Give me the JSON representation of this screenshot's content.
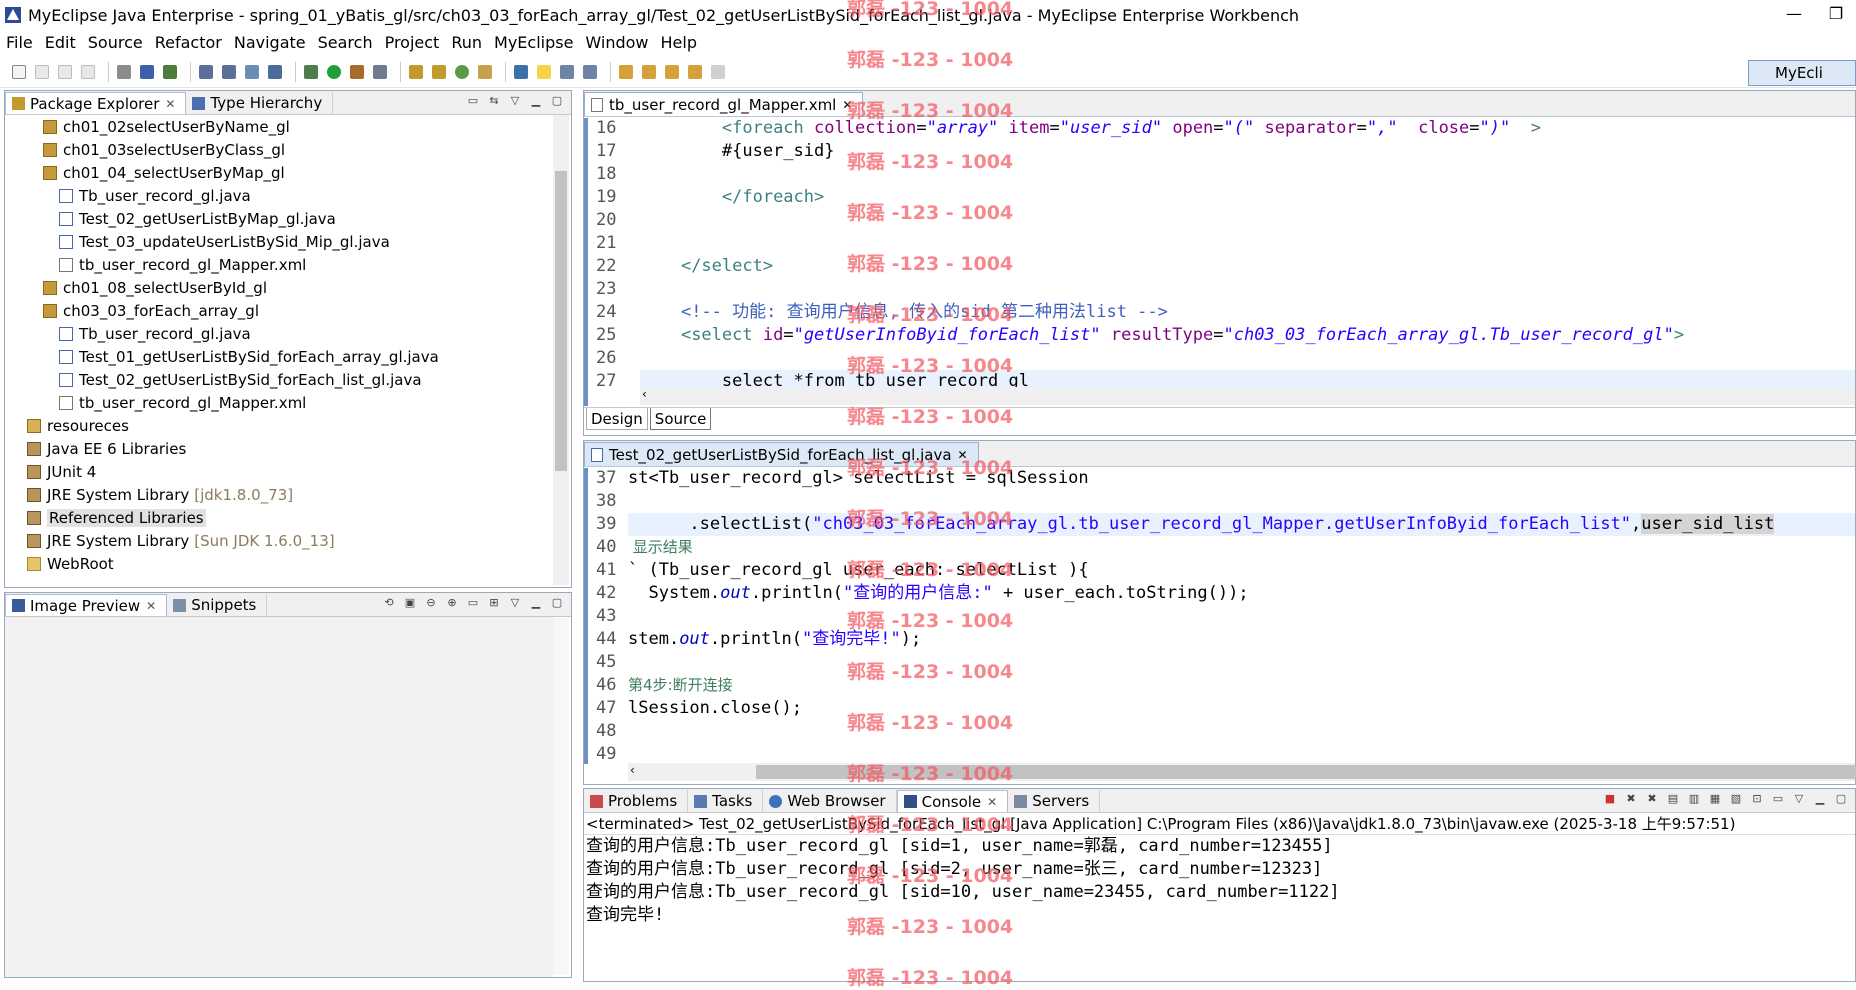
{
  "window": {
    "title": "MyEclipse Java Enterprise - spring_01_yBatis_gl/src/ch03_03_forEach_array_gl/Test_02_getUserListBySid_forEach_list_gl.java - MyEclipse Enterprise Workbench",
    "min_glyph": "—",
    "restore_glyph": "❐"
  },
  "menu": [
    "File",
    "Edit",
    "Source",
    "Refactor",
    "Navigate",
    "Search",
    "Project",
    "Run",
    "MyEclipse",
    "Window",
    "Help"
  ],
  "perspective": {
    "label": "MyEcli"
  },
  "package_explorer": {
    "tabs": [
      "Package Explorer",
      "Type Hierarchy"
    ],
    "items": [
      {
        "label": "ch01_02selectUserByName_gl",
        "indent": 2,
        "kind": "pkg"
      },
      {
        "label": "ch01_03selectUserByClass_gl",
        "indent": 2,
        "kind": "pkg"
      },
      {
        "label": "ch01_04_selectUserByMap_gl",
        "indent": 2,
        "kind": "pkg"
      },
      {
        "label": "Tb_user_record_gl.java",
        "indent": 3,
        "kind": "java"
      },
      {
        "label": "Test_02_getUserListByMap_gl.java",
        "indent": 3,
        "kind": "java"
      },
      {
        "label": "Test_03_updateUserListBySid_Mip_gl.java",
        "indent": 3,
        "kind": "java"
      },
      {
        "label": "tb_user_record_gl_Mapper.xml",
        "indent": 3,
        "kind": "xml"
      },
      {
        "label": "ch01_08_selectUserById_gl",
        "indent": 2,
        "kind": "pkg"
      },
      {
        "label": "ch03_03_forEach_array_gl",
        "indent": 2,
        "kind": "pkg"
      },
      {
        "label": "Tb_user_record_gl.java",
        "indent": 3,
        "kind": "java"
      },
      {
        "label": "Test_01_getUserListBySid_forEach_array_gl.java",
        "indent": 3,
        "kind": "java"
      },
      {
        "label": "Test_02_getUserListBySid_forEach_list_gl.java",
        "indent": 3,
        "kind": "java"
      },
      {
        "label": "tb_user_record_gl_Mapper.xml",
        "indent": 3,
        "kind": "xml"
      },
      {
        "label": "resoureces",
        "indent": 1,
        "kind": "src"
      },
      {
        "label": "Java EE 6 Libraries",
        "indent": 1,
        "kind": "lib"
      },
      {
        "label": "JUnit 4",
        "indent": 1,
        "kind": "lib"
      },
      {
        "label": "JRE System Library",
        "decor": "[jdk1.8.0_73]",
        "indent": 1,
        "kind": "lib"
      },
      {
        "label": "Referenced Libraries",
        "indent": 1,
        "kind": "lib",
        "selected": true
      },
      {
        "label": "JRE System Library",
        "decor": "[Sun JDK 1.6.0_13]",
        "indent": 1,
        "kind": "lib"
      },
      {
        "label": "WebRoot",
        "indent": 1,
        "kind": "fld"
      }
    ]
  },
  "image_preview": {
    "tabs": [
      "Image Preview",
      "Snippets"
    ]
  },
  "editor_xml": {
    "tab": "tb_user_record_gl_Mapper.xml",
    "line_numbers": [
      "16",
      "17",
      "18",
      "19",
      "20",
      "21",
      "22",
      "23",
      "24",
      "25",
      "26",
      "27"
    ],
    "bottom_tabs": [
      "Design",
      "Source"
    ]
  },
  "editor_java": {
    "tab": "Test_02_getUserListBySid_forEach_list_gl.java",
    "line_numbers": [
      "37",
      "38",
      "39",
      "40",
      "41",
      "42",
      "43",
      "44",
      "45",
      "46",
      "47",
      "48",
      "49"
    ]
  },
  "console": {
    "tabs": [
      "Problems",
      "Tasks",
      "Web Browser",
      "Console",
      "Servers"
    ],
    "status": "<terminated> Test_02_getUserListBySid_forEach_list_gl [Java Application] C:\\Program Files (x86)\\Java\\jdk1.8.0_73\\bin\\javaw.exe (2025-3-18 上午9:57:51)",
    "lines": [
      "查询的用户信息:Tb_user_record_gl [sid=1, user_name=郭磊, card_number=123455]",
      "查询的用户信息:Tb_user_record_gl [sid=2, user_name=张三, card_number=12323]",
      "查询的用户信息:Tb_user_record_gl [sid=10, user_name=23455, card_number=1122]",
      "查询完毕!"
    ]
  },
  "watermark": {
    "text": "郭磊 -123 - 1004"
  },
  "colors": {
    "watermark": "#f25a62",
    "accent": "#6c8fc7"
  }
}
